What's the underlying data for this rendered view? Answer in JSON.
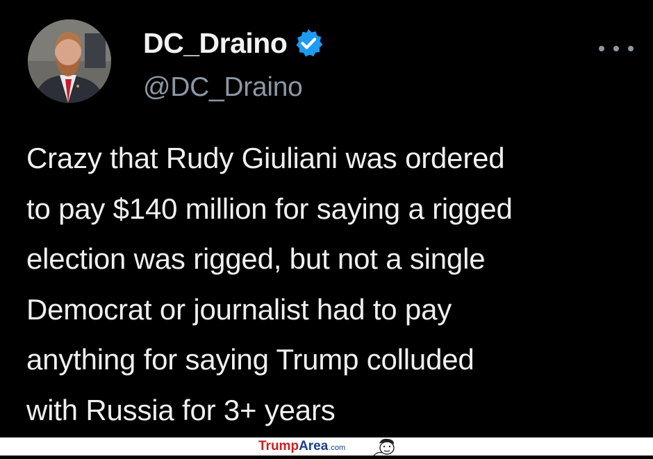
{
  "tweet": {
    "display_name": "DC_Draino",
    "handle": "@DC_Draino",
    "verified": true,
    "verified_color": "#1d9bf0",
    "lines": [
      "Crazy that Rudy Giuliani was ordered",
      "to pay $140 million for saying a rigged",
      "election was rigged, but not a single",
      "Democrat or journalist had to pay",
      "anything for saying Trump colluded",
      "with Russia for 3+ years"
    ],
    "icons": {
      "avatar": "avatar",
      "verified": "verified-badge-icon",
      "more": "more-options-icon"
    }
  },
  "watermark": {
    "brand_part1": "Trump",
    "brand_part2": "Area",
    "brand_suffix": ".com",
    "color_red": "#cc1f1f",
    "color_blue": "#1a3f8f"
  }
}
